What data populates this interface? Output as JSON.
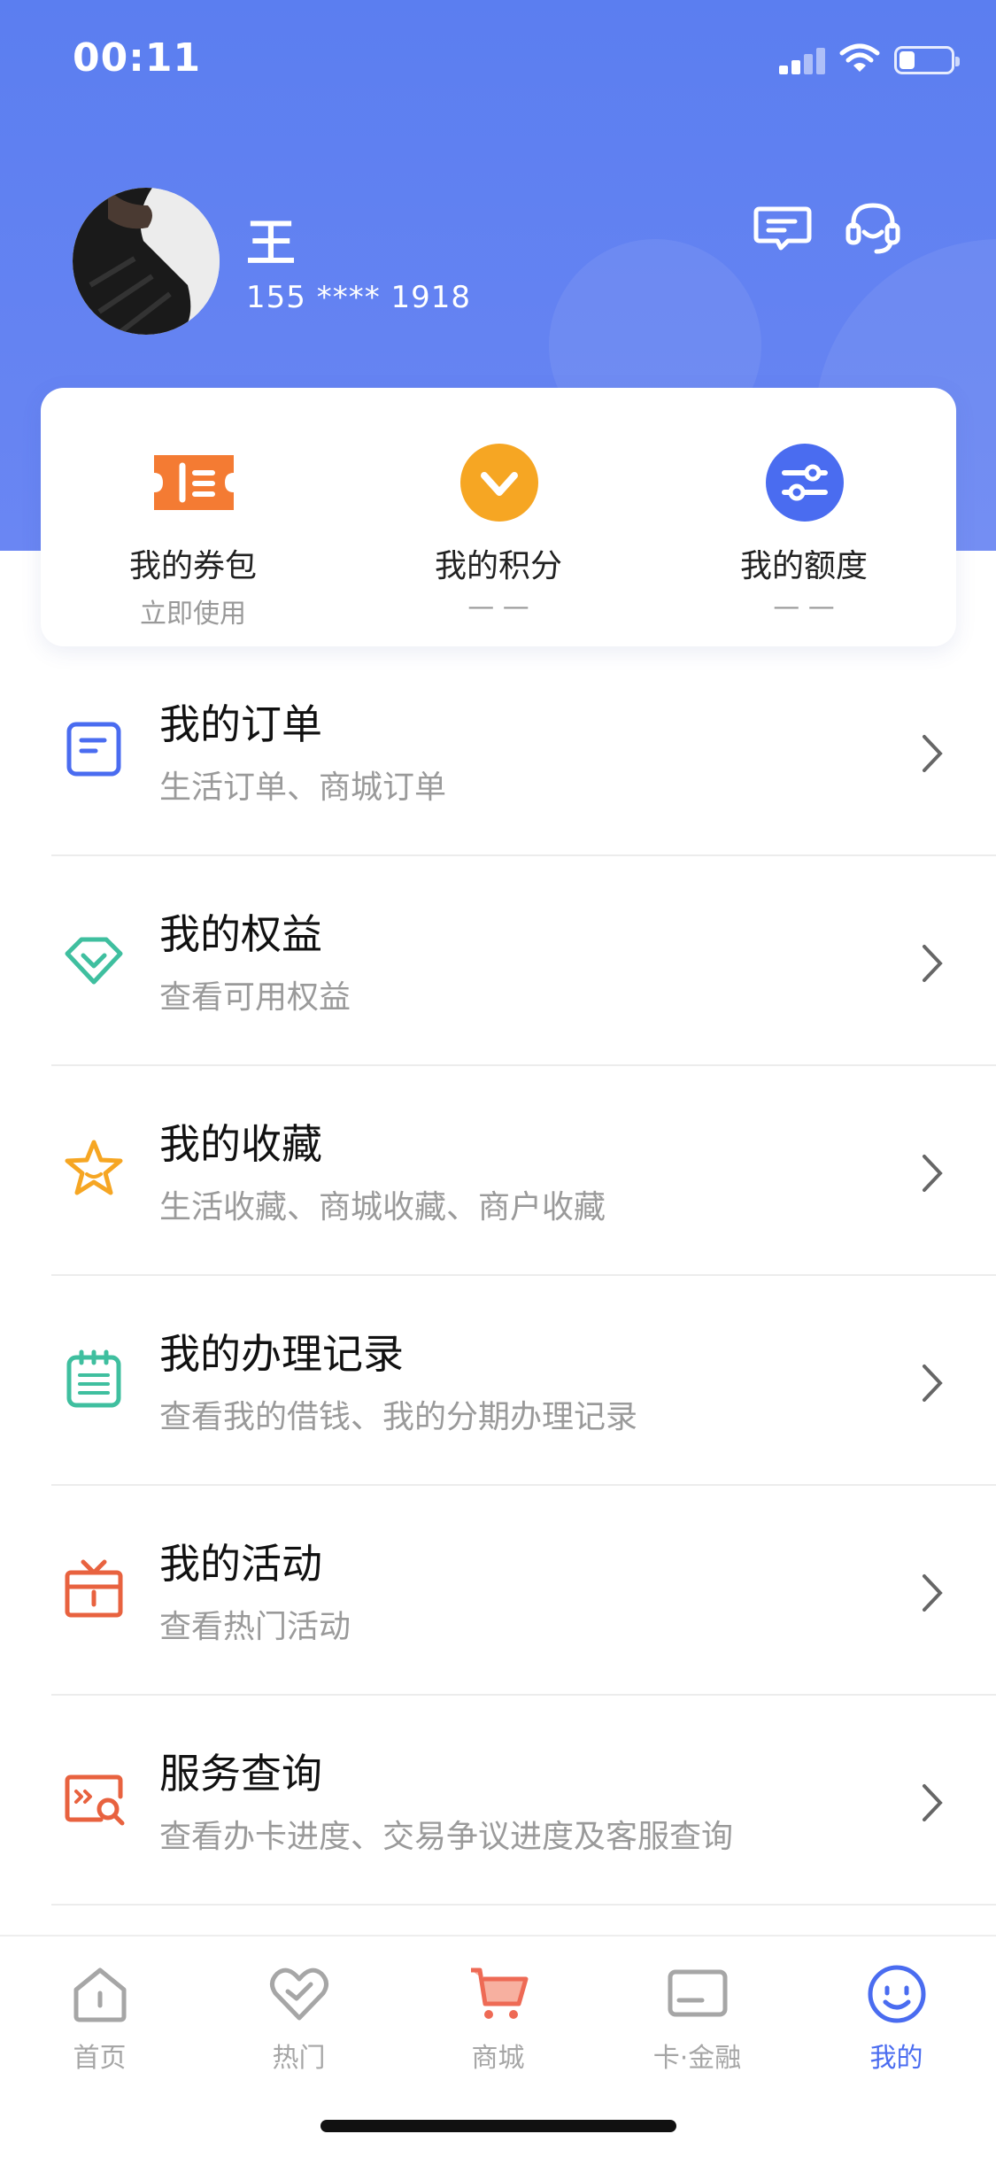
{
  "status_bar": {
    "time": "00:11",
    "signal_icon": "cellular-signal-icon",
    "wifi_icon": "wifi-icon",
    "battery_icon": "battery-icon",
    "battery_level": 0.3
  },
  "profile": {
    "name": "王",
    "phone": "155 **** 1918",
    "avatar_icon": "avatar-photo",
    "message_icon": "message-icon",
    "service_icon": "customer-service-icon"
  },
  "quick_actions": [
    {
      "label": "我的券包",
      "sub": "立即使用",
      "icon": "coupon-icon",
      "color": "#f47b33"
    },
    {
      "label": "我的积分",
      "sub": "— —",
      "icon": "points-icon",
      "color": "#f6a623"
    },
    {
      "label": "我的额度",
      "sub": "— —",
      "icon": "credit-limit-icon",
      "color": "#4a6cf0"
    }
  ],
  "menu": [
    {
      "title": "我的订单",
      "sub": "生活订单、商城订单",
      "icon": "order-icon",
      "color": "#4a6cf0"
    },
    {
      "title": "我的权益",
      "sub": "查看可用权益",
      "icon": "diamond-icon",
      "color": "#3fbf9f"
    },
    {
      "title": "我的收藏",
      "sub": "生活收藏、商城收藏、商户收藏",
      "icon": "star-icon",
      "color": "#f6a623"
    },
    {
      "title": "我的办理记录",
      "sub": "查看我的借钱、我的分期办理记录",
      "icon": "record-icon",
      "color": "#3fbf9f"
    },
    {
      "title": "我的活动",
      "sub": "查看热门活动",
      "icon": "gift-icon",
      "color": "#e8623f"
    },
    {
      "title": "服务查询",
      "sub": "查看办卡进度、交易争议进度及客服查询",
      "icon": "service-search-icon",
      "color": "#e8623f"
    }
  ],
  "tabs": [
    {
      "label": "首页",
      "icon": "home-icon",
      "active": false
    },
    {
      "label": "热门",
      "icon": "heart-icon",
      "active": false
    },
    {
      "label": "商城",
      "icon": "cart-icon",
      "active": false
    },
    {
      "label": "卡·金融",
      "icon": "card-icon",
      "active": false
    },
    {
      "label": "我的",
      "icon": "profile-smile-icon",
      "active": true
    }
  ],
  "colors": {
    "header_bg": "#5b7ef0",
    "accent": "#4a6cf0",
    "tab_inactive": "#a6a6a6"
  }
}
